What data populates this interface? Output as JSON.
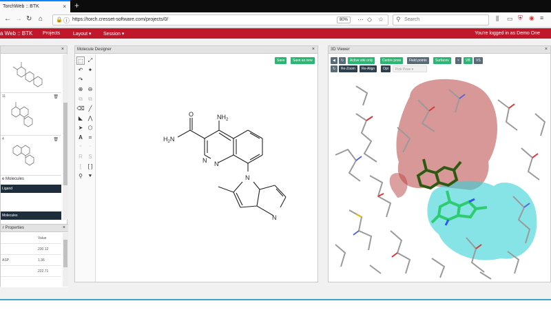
{
  "browser": {
    "tab_title": "TorchWeb :: BTK",
    "tab_close": "×",
    "new_tab": "+",
    "url": "https://torch.cresset-software.com/projects/0/",
    "zoom": "80%",
    "search_placeholder": "Search",
    "back_glyph": "←",
    "forward_glyph": "→",
    "reload_glyph": "↻",
    "home_glyph": "⌂"
  },
  "appbar": {
    "brand": "a Web :: BTK",
    "menu": [
      "Projects",
      "Layout ▾",
      "Session ▾"
    ],
    "login_status": "You're logged in as Demo One"
  },
  "left_panel": {
    "thumbnails": [
      {
        "label": ""
      },
      {
        "label": "11"
      },
      {
        "label": "4"
      }
    ],
    "section_title": "e Molecules",
    "dark_rows": [
      "Ligand",
      "Molecules"
    ],
    "props_title": "r Properties",
    "props_header": "Value",
    "props_values": [
      "230.12",
      "1.36",
      "222.71"
    ],
    "props_labels": [
      "",
      "",
      "ASP",
      "",
      ""
    ]
  },
  "designer": {
    "title": "Molecule Designer",
    "save_label": "Save",
    "save_as_label": "Save as new",
    "molecule_labels": {
      "nh2_top": "NH",
      "nh2_top_sub": "2",
      "o": "O",
      "h2n": "H",
      "h2n_sub": "2",
      "h2n_n": "N",
      "ring_n1": "N",
      "ring_n2": "N",
      "pyrrole_n": "N",
      "pyridine_n": "N"
    }
  },
  "viewer": {
    "title": "3D Viewer",
    "buttons_row1": [
      "Active site only",
      "Centre pose",
      "Field points",
      "Surfaces",
      "VB",
      "VS"
    ],
    "buttons_row2": [
      "Re-Zoom",
      "Re-Align",
      "Opt"
    ],
    "pick_pose": "Pick Pose",
    "colors": {
      "red_surface": "#b23a3a",
      "cyan_surface": "#2fc8cf",
      "ligand_green": "#2ecc71",
      "ligand_dark": "#2d5a12"
    }
  }
}
